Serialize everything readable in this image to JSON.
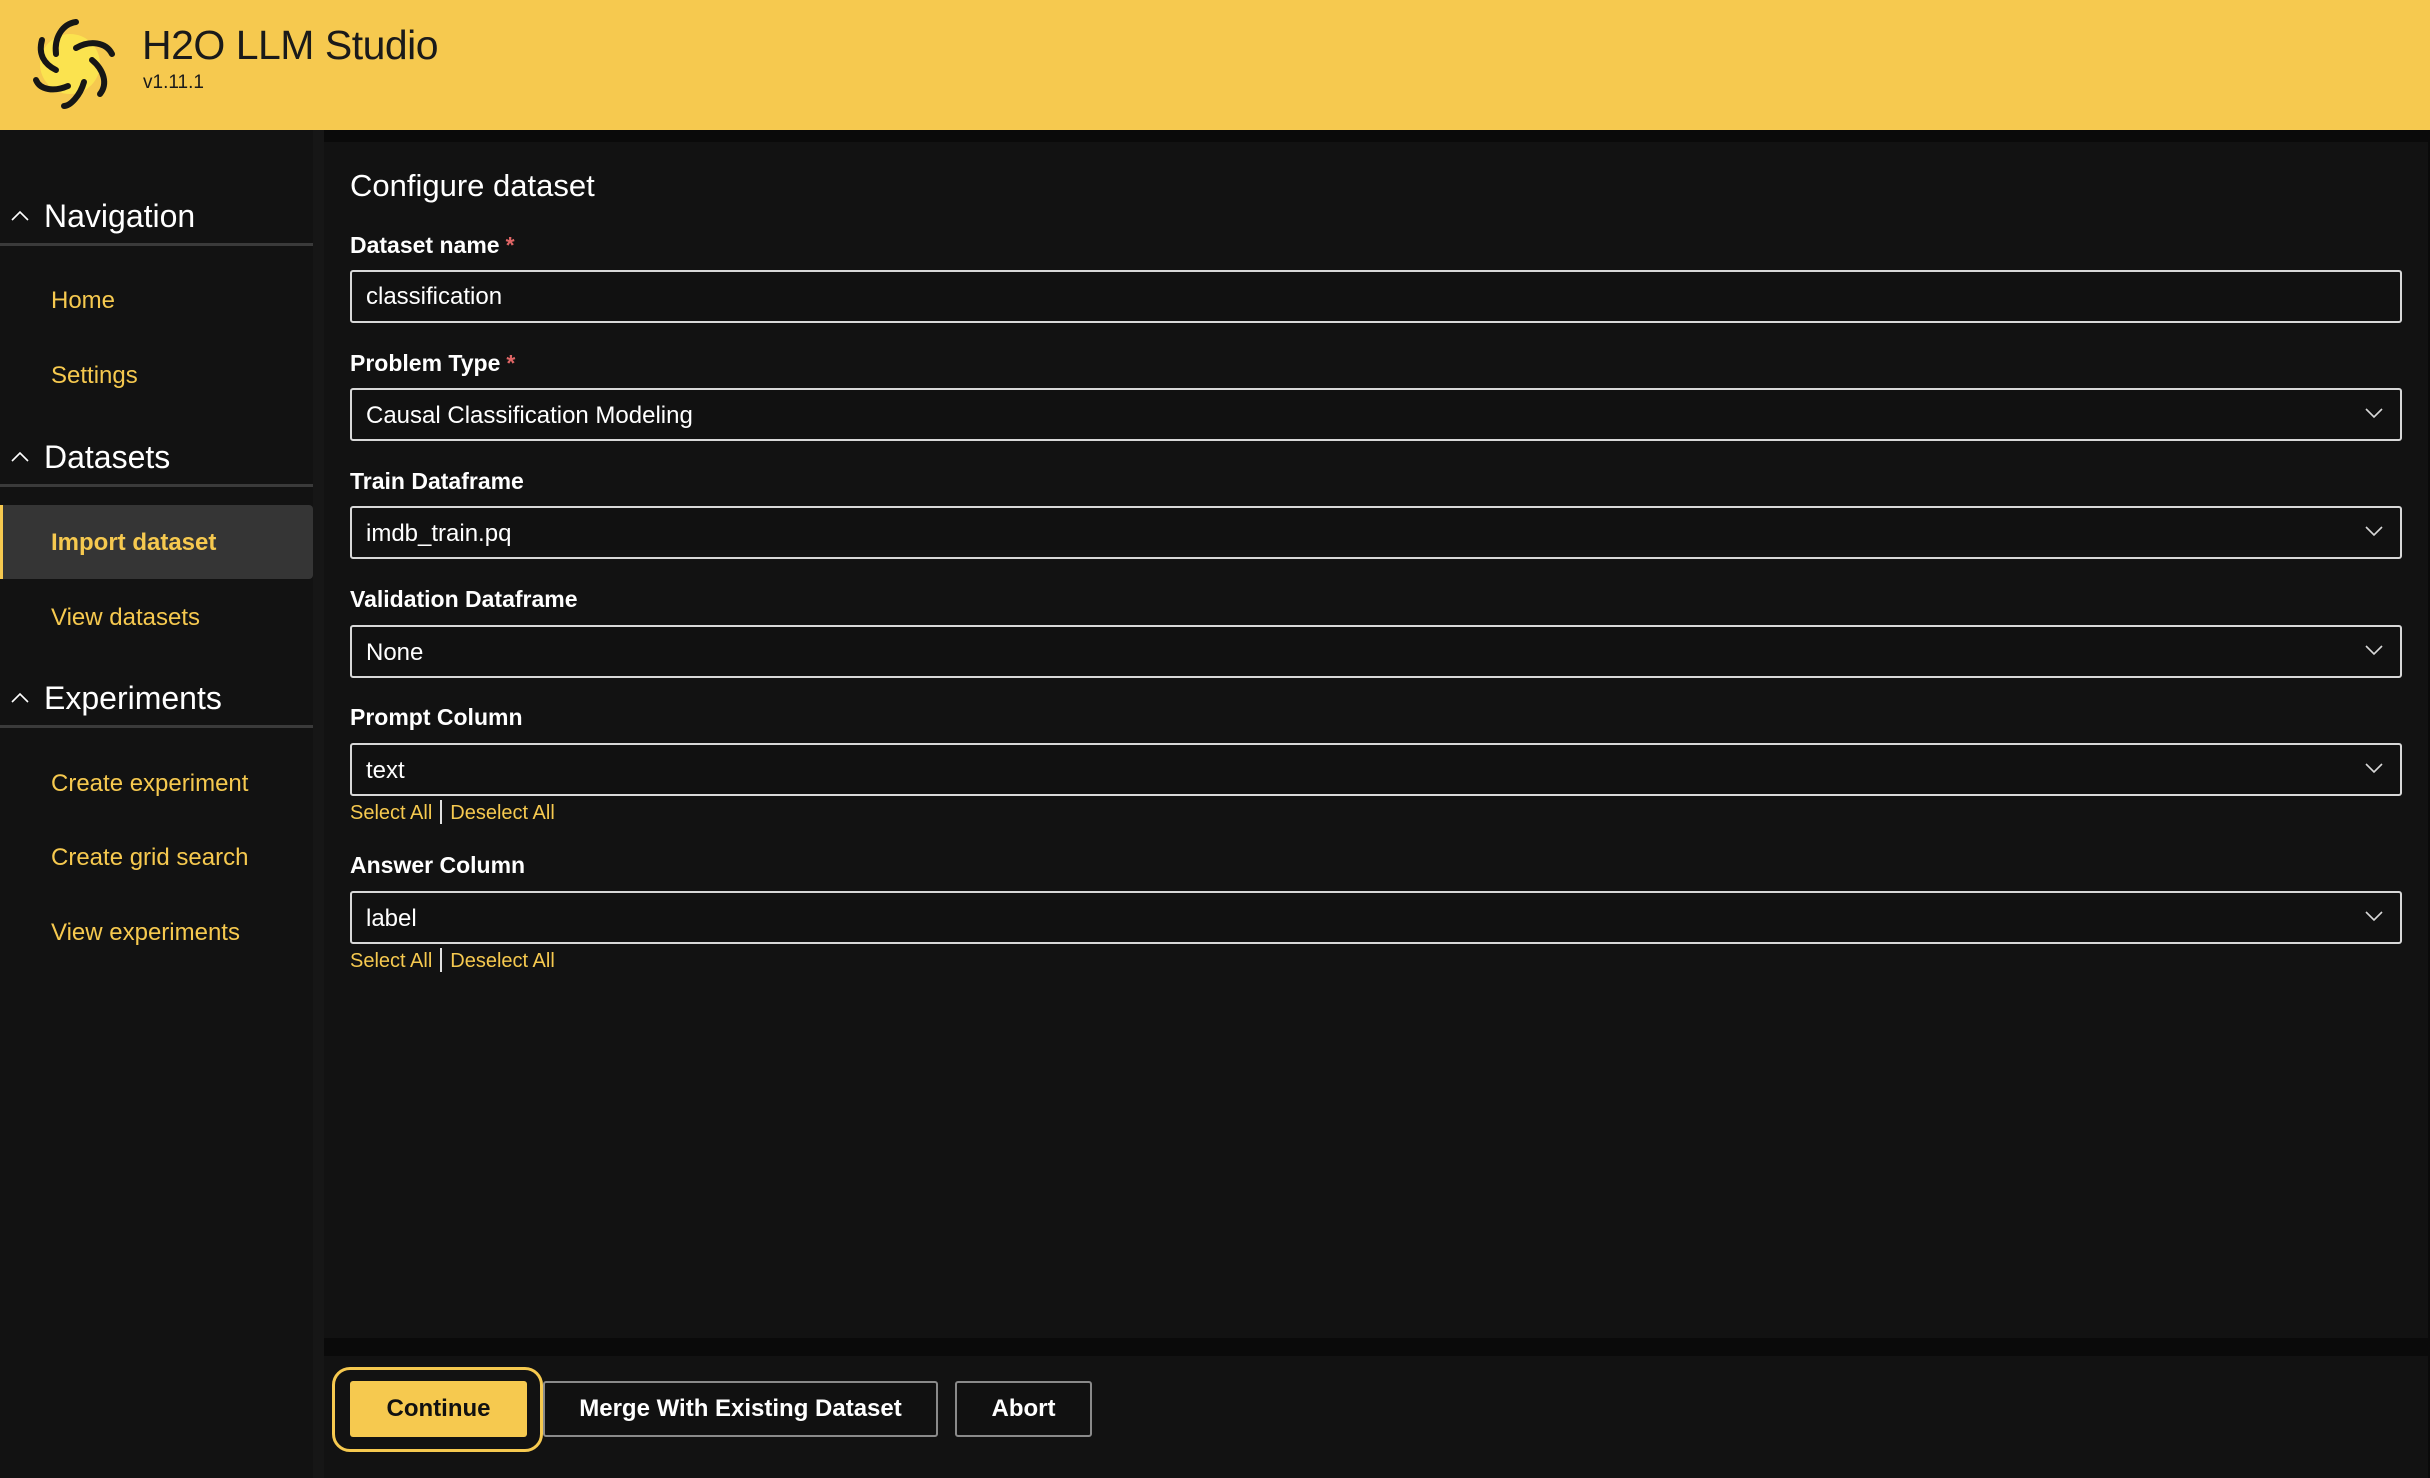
{
  "header": {
    "app_title": "H2O LLM Studio",
    "version": "v1.11.1",
    "logo_icon": "h2o-star-logo",
    "brand_color": "#f6c94f"
  },
  "sidebar": {
    "groups": [
      {
        "label": "Navigation",
        "expanded": true,
        "items": [
          {
            "label": "Home",
            "active": false
          },
          {
            "label": "Settings",
            "active": false
          }
        ]
      },
      {
        "label": "Datasets",
        "expanded": true,
        "items": [
          {
            "label": "Import dataset",
            "active": true
          },
          {
            "label": "View datasets",
            "active": false
          }
        ]
      },
      {
        "label": "Experiments",
        "expanded": true,
        "items": [
          {
            "label": "Create experiment",
            "active": false
          },
          {
            "label": "Create grid search",
            "active": false
          },
          {
            "label": "View experiments",
            "active": false
          }
        ]
      }
    ]
  },
  "form": {
    "title": "Configure dataset",
    "required_marker": "*",
    "dataset_name": {
      "label": "Dataset name",
      "required": true,
      "value": "classification"
    },
    "problem_type": {
      "label": "Problem Type",
      "required": true,
      "value": "Causal Classification Modeling"
    },
    "train_dataframe": {
      "label": "Train Dataframe",
      "value": "imdb_train.pq"
    },
    "validation_dataframe": {
      "label": "Validation Dataframe",
      "value": "None"
    },
    "prompt_column": {
      "label": "Prompt Column",
      "value": "text",
      "select_all": "Select All",
      "deselect_all": "Deselect All"
    },
    "answer_column": {
      "label": "Answer Column",
      "value": "label",
      "select_all": "Select All",
      "deselect_all": "Deselect All"
    }
  },
  "footer": {
    "continue_label": "Continue",
    "merge_label": "Merge With Existing Dataset",
    "abort_label": "Abort"
  }
}
